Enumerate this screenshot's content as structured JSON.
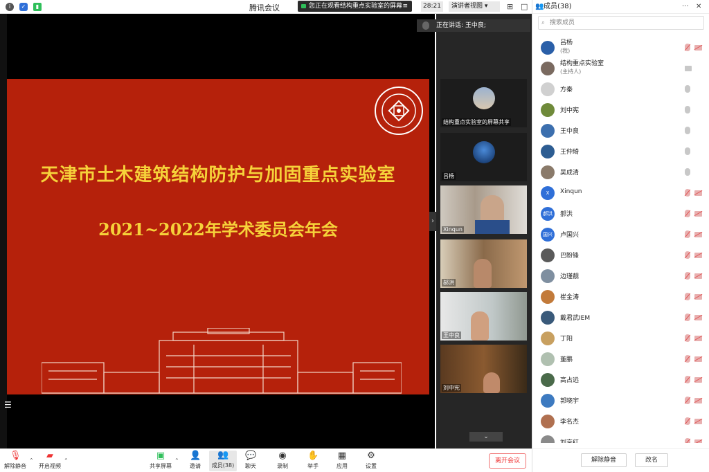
{
  "app": {
    "title": "腾讯会议"
  },
  "notice": {
    "viewing": "您正在观看结构重点实验室的屏幕",
    "menu": "≡"
  },
  "timer": "28:21",
  "view_mode": "演讲者视图 ▾",
  "window_controls": {
    "grid": "⊞",
    "min": "—",
    "max": "□",
    "close": "✕"
  },
  "slide": {
    "title": "天津市土木建筑结构防护与加固重点实验室",
    "subtitle": "2021~2022年学术委员会年会"
  },
  "speaking": {
    "label": "正在讲话:",
    "name": "王中良;"
  },
  "video_tiles": [
    {
      "name": "结构重点实验室的屏幕共享"
    },
    {
      "name": "吕杨"
    },
    {
      "name": "Xinqun"
    },
    {
      "name": "郝洪"
    },
    {
      "name": "王中良"
    },
    {
      "name": "刘中宪"
    }
  ],
  "toolbar": {
    "unmute": "解除静音",
    "video": "开启视频",
    "share": "共享屏幕",
    "invite": "邀请",
    "members": "成员(38)",
    "chat": "聊天",
    "record": "录制",
    "raise_hand": "举手",
    "apps": "应用",
    "settings": "设置",
    "leave": "离开会议"
  },
  "panel": {
    "title": "成员(38)",
    "search_placeholder": "搜索成员",
    "members": [
      {
        "name": "吕杨",
        "role": "(我)",
        "color": "#2a5fa8"
      },
      {
        "name": "结构重点实验室",
        "role": "(主持人)",
        "color": "#7a6a60"
      },
      {
        "name": "方秦",
        "role": "",
        "color": "#d0d0d0"
      },
      {
        "name": "刘中宪",
        "role": "",
        "color": "#6f8a3a"
      },
      {
        "name": "王中良",
        "role": "",
        "color": "#3c6fae"
      },
      {
        "name": "王仲琦",
        "role": "",
        "color": "#2d5d92"
      },
      {
        "name": "吴成清",
        "role": "",
        "color": "#8a7a6a"
      },
      {
        "name": "Xinqun",
        "role": "",
        "color": "#2f6fd8",
        "initial": "X"
      },
      {
        "name": "郝洪",
        "role": "",
        "color": "#2f6fd8",
        "initial": "郝洪"
      },
      {
        "name": "卢国兴",
        "role": "",
        "color": "#2f6fd8",
        "initial": "国兴"
      },
      {
        "name": "巴盼锋",
        "role": "",
        "color": "#5a5a5a"
      },
      {
        "name": "边瑾靓",
        "role": "",
        "color": "#7f8fa0"
      },
      {
        "name": "崔金涛",
        "role": "",
        "color": "#c27a3a"
      },
      {
        "name": "戴君武IEM",
        "role": "",
        "color": "#3a5a7a"
      },
      {
        "name": "丁阳",
        "role": "",
        "color": "#c8a060"
      },
      {
        "name": "董鹏",
        "role": "",
        "color": "#b0c0b0"
      },
      {
        "name": "高占远",
        "role": "",
        "color": "#4a6a4a"
      },
      {
        "name": "郭晓宇",
        "role": "",
        "color": "#3d7ac0"
      },
      {
        "name": "李名杰",
        "role": "",
        "color": "#b07050"
      },
      {
        "name": "刘京红",
        "role": "",
        "color": "#8a8a8a"
      }
    ],
    "unmute_all": "解除静音",
    "rename": "改名"
  }
}
